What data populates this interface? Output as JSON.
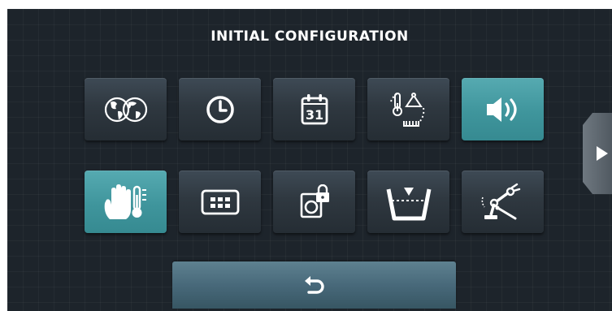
{
  "header": {
    "title": "INITIAL CONFIGURATION"
  },
  "tiles": [
    {
      "icon": "globe-language-icon",
      "active": false
    },
    {
      "icon": "clock-icon",
      "active": false
    },
    {
      "icon": "calendar-icon",
      "label": "31",
      "active": false
    },
    {
      "icon": "temperature-weight-icon",
      "active": false
    },
    {
      "icon": "speaker-volume-icon",
      "active": true
    },
    {
      "icon": "hand-temperature-icon",
      "active": true
    },
    {
      "icon": "keypad-icon",
      "active": false
    },
    {
      "icon": "machine-lock-icon",
      "active": false
    },
    {
      "icon": "water-level-icon",
      "active": false
    },
    {
      "icon": "robotic-arm-icon",
      "active": false
    }
  ],
  "navigation": {
    "next_icon": "play-arrow-icon",
    "back_icon": "undo-arrow-icon"
  },
  "colors": {
    "active_tile": "#3f959c",
    "background": "#1d242b",
    "back_bar": "#48697a"
  }
}
